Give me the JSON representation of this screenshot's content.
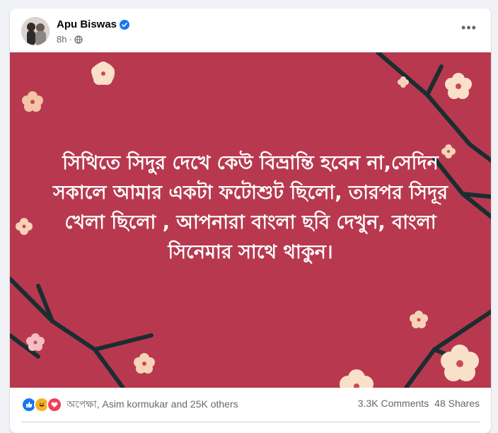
{
  "post": {
    "author": "Apu Biswas",
    "timestamp": "8h",
    "separator": "·",
    "audience_icon": "globe-icon",
    "verified_icon": "verified-badge-icon",
    "more_icon": "more-options-icon",
    "more_label": "•••",
    "text": "সিথিতে সিদুর দেখে কেউ বিভ্রান্তি হবেন না,সেদিন সকালে আমার একটা ফটোশুট ছিলো, তারপর সিদূর খেলা ছিলো , আপনারা বাংলা ছবি দেখুন, বাংলা সিনেমার সাথে থাকুন।",
    "image_colors": {
      "background": "#b8394f",
      "branch": "#1b2d30",
      "flower": "#f6d3b8",
      "flower_center": "#c94a52"
    }
  },
  "engagement": {
    "reaction_icons": [
      "like-icon",
      "haha-icon",
      "love-icon"
    ],
    "reactions_text": "অপেক্ষা, Asim kormukar and 25K others",
    "comments": "3.3K Comments",
    "shares": "48 Shares"
  },
  "colors": {
    "like": "#1877f2",
    "haha": "#f7b125",
    "love": "#f33e58",
    "verified": "#1877f2"
  }
}
